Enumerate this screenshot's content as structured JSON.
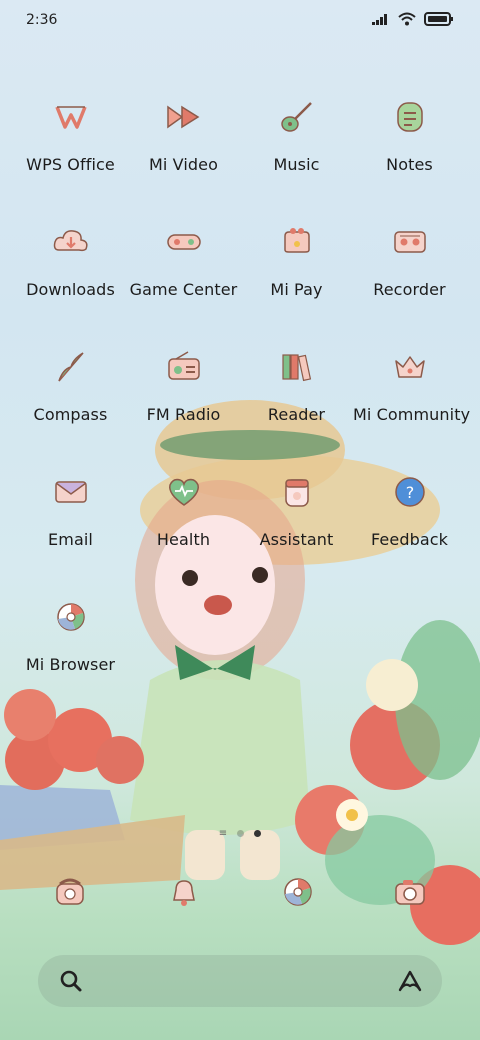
{
  "status": {
    "time": "2:36"
  },
  "apps": [
    {
      "label": "WPS Office",
      "icon": "wps-office-icon"
    },
    {
      "label": "Mi Video",
      "icon": "play-icon"
    },
    {
      "label": "Music",
      "icon": "guitar-icon"
    },
    {
      "label": "Notes",
      "icon": "notes-icon"
    },
    {
      "label": "Downloads",
      "icon": "download-cloud-icon"
    },
    {
      "label": "Game Center",
      "icon": "gamepad-icon"
    },
    {
      "label": "Mi Pay",
      "icon": "wallet-icon"
    },
    {
      "label": "Recorder",
      "icon": "recorder-icon"
    },
    {
      "label": "Compass",
      "icon": "compass-icon"
    },
    {
      "label": "FM Radio",
      "icon": "radio-icon"
    },
    {
      "label": "Reader",
      "icon": "books-icon"
    },
    {
      "label": "Mi Community",
      "icon": "crown-icon"
    },
    {
      "label": "Email",
      "icon": "envelope-icon"
    },
    {
      "label": "Health",
      "icon": "heart-icon"
    },
    {
      "label": "Assistant",
      "icon": "jar-icon"
    },
    {
      "label": "Feedback",
      "icon": "question-icon"
    },
    {
      "label": "Mi Browser",
      "icon": "browser-icon"
    }
  ],
  "dock": [
    {
      "icon": "phone-icon"
    },
    {
      "icon": "bell-icon"
    },
    {
      "icon": "browser-icon"
    },
    {
      "icon": "camera-icon"
    }
  ],
  "colors": {
    "accent": "#e07a6a",
    "outline": "#8c5a4a",
    "green": "#7fc08a"
  }
}
